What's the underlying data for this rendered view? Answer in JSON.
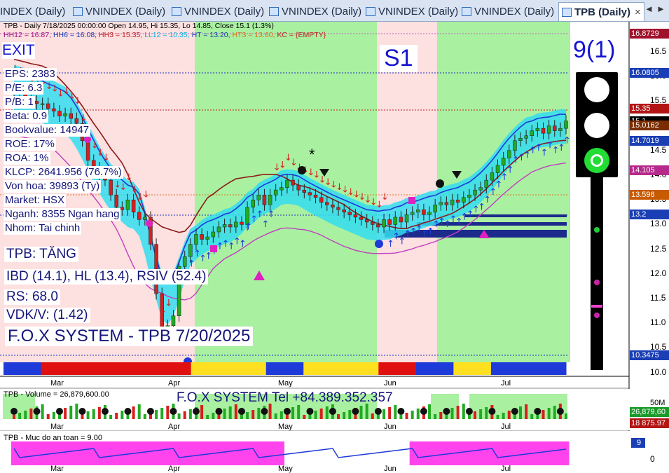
{
  "tabs": [
    {
      "label": "INDEX (Daily)",
      "active": false
    },
    {
      "label": "VNINDEX (Daily)",
      "active": false
    },
    {
      "label": "VNINDEX (Daily)",
      "active": false
    },
    {
      "label": "VNINDEX (Daily)",
      "active": false
    },
    {
      "label": "VNINDEX (Daily)",
      "active": false
    },
    {
      "label": "VNINDEX (Daily)",
      "active": false
    },
    {
      "label": "TPB (Daily)",
      "active": true
    }
  ],
  "nav": {
    "prev": "◄",
    "next": "►"
  },
  "header": {
    "line1": "TPB - Daily 7/18/2025 00:00:00 Open 14.95, Hi 15.35, Lo 14.85, Close 15.1 (1.3%)",
    "hh12": "HH12 = 16.87,",
    "hh6": "HH6 = 16.08,",
    "hh3": "HH3 = 15.35,",
    "ll12": "LL12 = 10.35,",
    "ht": "HT = 13.20,",
    "ht3": "HT3 = 13.60,",
    "kc": "KC = {EMPTY}"
  },
  "signals": {
    "exit": "EXIT",
    "s1": "S1",
    "zero_mark": "0",
    "star": "*"
  },
  "fundamentals": [
    "EPS: 2383",
    "P/E: 6.3",
    "P/B: 1",
    "Beta: 0.9",
    "Bookvalue: 14947",
    "ROE: 17%",
    "ROA: 1%",
    "KLCP: 2641.956 (76.7%)",
    "Von hoa: 39893 (Ty)",
    "Market: HSX",
    "Nganh: 8355 Ngan hang",
    "Nhom: Tai chinh"
  ],
  "analysis": {
    "trend": "TPB: TĂNG",
    "ibd": "IBD (14.1), HL (13.4), RSIV (52.4)",
    "rs": "RS: 68.0",
    "vdk": "VDK/V:  (1.42)",
    "brand": "F.O.X SYSTEM - TPB 7/20/2025"
  },
  "traffic_light": {
    "label": "9(1)",
    "lit": "green"
  },
  "price_axis": {
    "ticks": [
      "16.5",
      "16.0",
      "15.5",
      "15.0",
      "14.5",
      "14.0",
      "13.5",
      "13.0",
      "12.5",
      "12.0",
      "11.5",
      "11.0",
      "10.5",
      "10.0"
    ],
    "boxes": [
      {
        "text": "16.8729",
        "color": "#a0122c"
      },
      {
        "text": "16.0805",
        "color": "#1a3fb5"
      },
      {
        "text": "15.35",
        "color": "#b31515"
      },
      {
        "text": "15.1",
        "color": "#000000"
      },
      {
        "text": "15.0162",
        "color": "#7a2d00"
      },
      {
        "text": "14.7019",
        "color": "#1a3fb5"
      },
      {
        "text": "14.105",
        "color": "#b52a8a"
      },
      {
        "text": "13.596",
        "color": "#c85a00"
      },
      {
        "text": "13.2",
        "color": "#1a3fb5"
      },
      {
        "text": "10.3475",
        "color": "#1a3fb5"
      }
    ]
  },
  "months": [
    "Mar",
    "Apr",
    "May",
    "Jun",
    "Jul"
  ],
  "volume": {
    "title": "TPB - Volume = 26,879,600.00",
    "banner": "F.O.X SYSTEM Tel +84.389.352.357",
    "axis": "50M",
    "box1": "26,879,60",
    "box2": "18 875.97"
  },
  "safety": {
    "title": "TPB - Muc do an toan = 9.00",
    "value_box": "9",
    "axis": "0"
  },
  "chart_data": {
    "type": "candlestick",
    "ylim": [
      9.9,
      16.9
    ],
    "dates": [
      "2/27",
      "2/28",
      "3/3",
      "3/4",
      "3/5",
      "3/6",
      "3/7",
      "3/10",
      "3/11",
      "3/12",
      "3/13",
      "3/14",
      "3/17",
      "3/18",
      "3/19",
      "3/20",
      "3/21",
      "3/24",
      "3/25",
      "3/26",
      "3/27",
      "3/28",
      "3/31",
      "4/1",
      "4/2",
      "4/3",
      "4/4",
      "4/8",
      "4/9",
      "4/10",
      "4/11",
      "4/14",
      "4/15",
      "4/16",
      "4/17",
      "4/18",
      "4/21",
      "4/22",
      "4/23",
      "4/24",
      "4/25",
      "4/28",
      "4/29",
      "5/5",
      "5/6",
      "5/7",
      "5/8",
      "5/9",
      "5/12",
      "5/13",
      "5/14",
      "5/15",
      "5/16",
      "5/19",
      "5/20",
      "5/21",
      "5/22",
      "5/23",
      "5/26",
      "5/27",
      "5/28",
      "5/29",
      "5/30",
      "6/2",
      "6/3",
      "6/4",
      "6/5",
      "6/6",
      "6/9",
      "6/10",
      "6/11",
      "6/12",
      "6/13",
      "6/16",
      "6/17",
      "6/18",
      "6/19",
      "6/20",
      "6/23",
      "6/24",
      "6/25",
      "6/26",
      "6/27",
      "6/30",
      "7/1",
      "7/2",
      "7/3",
      "7/4",
      "7/7",
      "7/8",
      "7/9",
      "7/10",
      "7/11",
      "7/14",
      "7/15",
      "7/16",
      "7/17",
      "7/18"
    ],
    "close": [
      15.7,
      15.65,
      15.55,
      15.5,
      15.45,
      15.45,
      15.35,
      15.3,
      15.2,
      15.25,
      15.15,
      15.05,
      14.7,
      14.3,
      14.15,
      14.0,
      13.9,
      13.6,
      13.35,
      13.3,
      13.5,
      13.25,
      13.1,
      13.15,
      12.6,
      11.6,
      10.8,
      10.95,
      11.15,
      12.15,
      12.35,
      12.6,
      12.8,
      12.7,
      12.75,
      12.85,
      12.95,
      13.0,
      12.95,
      13.05,
      13.0,
      13.35,
      13.5,
      13.6,
      13.4,
      13.6,
      13.7,
      13.75,
      13.9,
      13.8,
      13.7,
      13.65,
      13.6,
      13.55,
      13.45,
      13.4,
      13.35,
      13.3,
      13.25,
      13.2,
      13.15,
      13.1,
      13.05,
      13.0,
      12.95,
      13.1,
      13.0,
      13.15,
      13.05,
      13.2,
      13.25,
      13.3,
      13.2,
      13.25,
      13.4,
      13.45,
      13.4,
      13.5,
      13.45,
      13.55,
      13.6,
      13.7,
      13.75,
      13.9,
      14.05,
      14.2,
      14.35,
      14.5,
      14.7,
      14.75,
      14.8,
      14.9,
      14.95,
      14.85,
      15.0,
      14.9,
      14.95,
      15.1
    ],
    "hh12": 16.87,
    "hh6": 16.08,
    "hh3": 15.35,
    "ll12": 10.35,
    "ht": 13.2,
    "ht3": 13.6
  }
}
